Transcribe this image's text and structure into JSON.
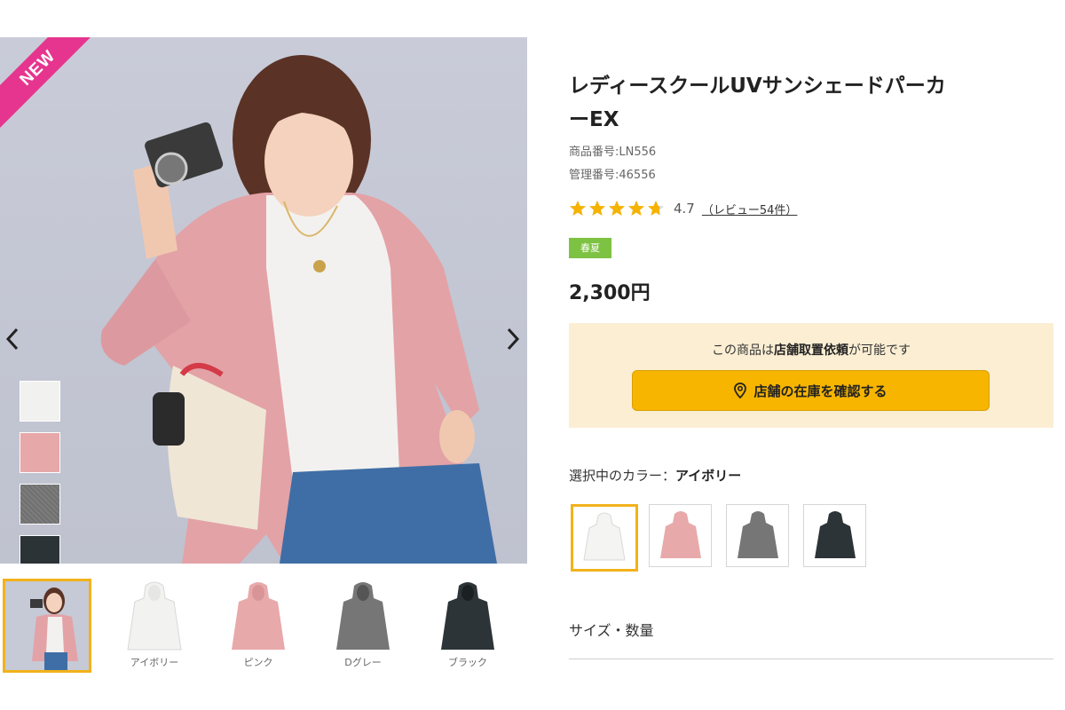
{
  "product": {
    "badge": "NEW",
    "title_line1": "レディースクールUVサンシェードパーカ",
    "title_line2": "ーEX",
    "item_number": "商品番号:LN556",
    "management_number": "管理番号:46556",
    "rating": "4.7",
    "rating_value": 4.7,
    "review_link": "（レビュー54件）",
    "season": "春夏",
    "price": "2,300円"
  },
  "store": {
    "text_prefix": "この商品は",
    "text_bold": "店舗取置依頼",
    "text_suffix": "が可能です",
    "button_label": "店舗の在庫を確認する",
    "button_color": "#f7b500"
  },
  "color": {
    "label_prefix": "選択中のカラー：",
    "selected": "アイボリー"
  },
  "thumbnails": [
    {
      "label": ""
    },
    {
      "label": "アイボリー"
    },
    {
      "label": "ピンク"
    },
    {
      "label": "Dグレー"
    },
    {
      "label": "ブラック"
    }
  ],
  "size": {
    "label": "サイズ・数量"
  },
  "colors": {
    "accent": "#f2b21b",
    "new_badge": "#e6358f",
    "season_badge": "#7dc242",
    "ivory": "#f1f1ef",
    "pink": "#e7a8aa",
    "dark_grey": "#747474",
    "black": "#2c3336"
  },
  "icons": {
    "prev": "chevron-left-icon",
    "next": "chevron-right-icon",
    "store_button": "map-pin-icon",
    "rating": "star-icon"
  }
}
